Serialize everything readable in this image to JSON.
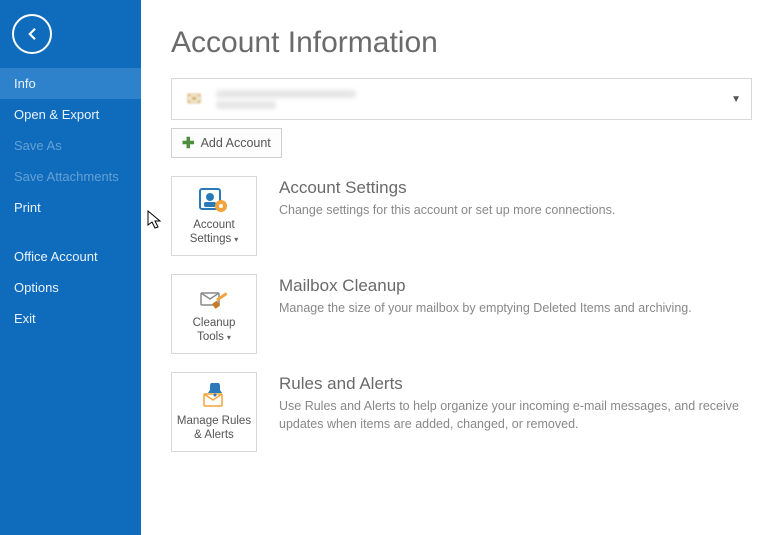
{
  "sidebar": {
    "items": [
      {
        "label": "Info",
        "selected": true,
        "disabled": false
      },
      {
        "label": "Open & Export",
        "selected": false,
        "disabled": false
      },
      {
        "label": "Save As",
        "selected": false,
        "disabled": true
      },
      {
        "label": "Save Attachments",
        "selected": false,
        "disabled": true
      },
      {
        "label": "Print",
        "selected": false,
        "disabled": false
      }
    ],
    "bottom_items": [
      {
        "label": "Office Account"
      },
      {
        "label": "Options"
      },
      {
        "label": "Exit"
      }
    ]
  },
  "page": {
    "title": "Account Information",
    "add_account_label": "Add Account",
    "cards": [
      {
        "btn_line1": "Account",
        "btn_line2": "Settings",
        "has_caret": true,
        "heading": "Account Settings",
        "desc": "Change settings for this account or set up more connections."
      },
      {
        "btn_line1": "Cleanup",
        "btn_line2": "Tools",
        "has_caret": true,
        "heading": "Mailbox Cleanup",
        "desc": "Manage the size of your mailbox by emptying Deleted Items and archiving."
      },
      {
        "btn_line1": "Manage Rules",
        "btn_line2": "& Alerts",
        "has_caret": false,
        "heading": "Rules and Alerts",
        "desc": "Use Rules and Alerts to help organize your incoming e-mail messages, and receive updates when items are added, changed, or removed."
      }
    ]
  }
}
